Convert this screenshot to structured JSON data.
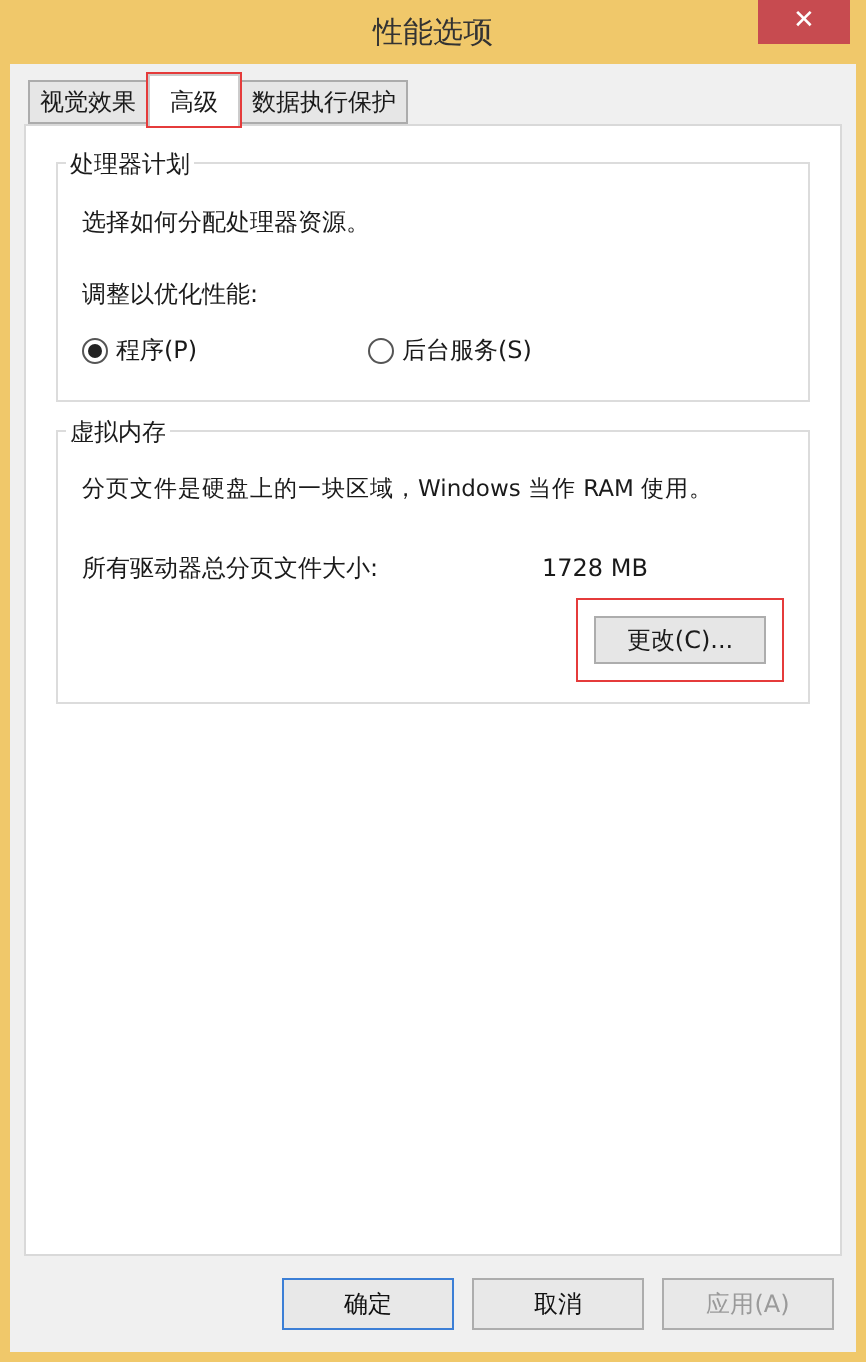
{
  "window": {
    "title": "性能选项",
    "close": "✕"
  },
  "tabs": [
    {
      "label": "视觉效果",
      "selected": false,
      "highlighted": false
    },
    {
      "label": "高级",
      "selected": true,
      "highlighted": true
    },
    {
      "label": "数据执行保护",
      "selected": false,
      "highlighted": false
    }
  ],
  "processor_group": {
    "title": "处理器计划",
    "description": "选择如何分配处理器资源。",
    "adjust_label": "调整以优化性能:",
    "options": [
      {
        "label": "程序(P)",
        "selected": true
      },
      {
        "label": "后台服务(S)",
        "selected": false
      }
    ]
  },
  "memory_group": {
    "title": "虚拟内存",
    "description": "分页文件是硬盘上的一块区域，Windows 当作 RAM 使用。",
    "size_label": "所有驱动器总分页文件大小:",
    "size_value": "1728 MB",
    "change_button": {
      "label": "更改(C)...",
      "highlighted": true
    }
  },
  "buttons": [
    {
      "label": "确定",
      "default": true,
      "disabled": false
    },
    {
      "label": "取消",
      "default": false,
      "disabled": false
    },
    {
      "label": "应用(A)",
      "default": false,
      "disabled": true
    }
  ]
}
